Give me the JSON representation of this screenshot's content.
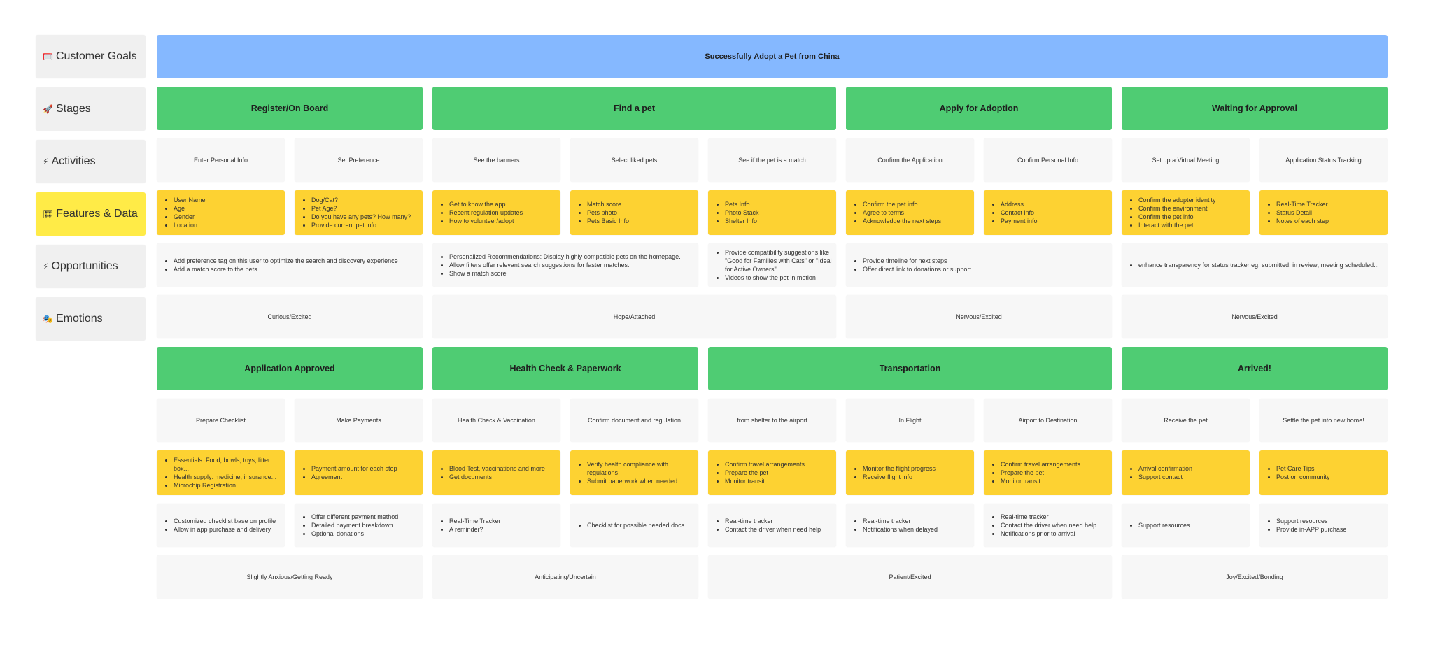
{
  "colors": {
    "goal": "#85b8ff",
    "stage": "#4fcc73",
    "feature": "#fdd232",
    "label_highlight": "#ffeb47",
    "card": "#f7f7f7"
  },
  "labels": [
    {
      "icon": "🥅",
      "text": "Customer Goals"
    },
    {
      "icon": "🚀",
      "text": "Stages"
    },
    {
      "icon": "⚡",
      "text": "Activities"
    },
    {
      "icon": "🎛",
      "text": "Features & Data",
      "highlight": true
    },
    {
      "icon": "⚡",
      "text": "Opportunities"
    },
    {
      "icon": "🎭",
      "text": "Emotions"
    }
  ],
  "goal": "Successfully Adopt a Pet from China",
  "sections": [
    {
      "stages": [
        {
          "label": "Register/On Board",
          "span": 2
        },
        {
          "label": "Find a pet",
          "span": 3
        },
        {
          "label": "Apply for Adoption",
          "span": 2
        },
        {
          "label": "Waiting for Approval",
          "span": 2
        }
      ],
      "activities": [
        "Enter Personal Info",
        "Set Preference",
        "See the banners",
        "Select liked pets",
        "See if the pet is a match",
        "Confirm the Application",
        "Confirm Personal Info",
        "Set up a Virtual Meeting",
        "Application Status Tracking"
      ],
      "features": [
        [
          "User Name",
          "Age",
          "Gender",
          "Location..."
        ],
        [
          "Dog/Cat?",
          "Pet Age?",
          "Do you have any pets? How many?",
          "Provide current pet info"
        ],
        [
          "Get to know the app",
          "Recent regulation updates",
          "How to volunteer/adopt"
        ],
        [
          "Match score",
          "Pets photo",
          "Pets Basic Info"
        ],
        [
          "Pets Info",
          "Photo Stack",
          "Shelter Info"
        ],
        [
          "Confirm the pet info",
          "Agree to terms",
          "Acknowledge the next steps"
        ],
        [
          "Address",
          "Contact info",
          "Payment info"
        ],
        [
          "Confirm the adopter identity",
          "Confirm the environment",
          "Confirm the pet info",
          "Interact with the pet..."
        ],
        [
          "Real-Time Tracker",
          "Status Detail",
          "Notes of each step"
        ]
      ],
      "opportunities": [
        {
          "span": 2,
          "items": [
            "Add preference tag on this user to optimize the search and discovery experience",
            "Add a match score to the pets"
          ]
        },
        {
          "span": 2,
          "items": [
            "Personalized Recommendations: Display highly compatible pets on the homepage.",
            "Allow filters offer relevant search suggestions for faster matches.",
            "Show a match score"
          ]
        },
        {
          "span": 1,
          "items": [
            "Provide compatibility suggestions like \"Good for Families with Cats\" or \"Ideal for Active Owners\"",
            "Videos to show the pet in motion"
          ]
        },
        {
          "span": 2,
          "items": [
            "Provide timeline for next steps",
            "Offer direct link to donations or support"
          ]
        },
        {
          "span": 2,
          "items": [
            "enhance transparency for status tracker eg. submitted; in review; meeting scheduled..."
          ]
        }
      ],
      "emotions": [
        {
          "label": "Curious/Excited",
          "span": 2
        },
        {
          "label": "Hope/Attached",
          "span": 3
        },
        {
          "label": "Nervous/Excited",
          "span": 2
        },
        {
          "label": "Nervous/Excited",
          "span": 2
        }
      ]
    },
    {
      "stages": [
        {
          "label": "Application Approved",
          "span": 2
        },
        {
          "label": "Health Check & Paperwork",
          "span": 2
        },
        {
          "label": "Transportation",
          "span": 3
        },
        {
          "label": "Arrived!",
          "span": 2
        }
      ],
      "activities": [
        "Prepare Checklist",
        "Make Payments",
        "Health Check & Vaccination",
        "Confirm document and regulation",
        "from shelter to the airport",
        "In Flight",
        "Airport to Destination",
        "Receive the pet",
        "Settle the pet into new home!"
      ],
      "features": [
        [
          "Essentials: Food, bowls, toys, litter box...",
          "Health supply: medicine, insurance...",
          "Microchip Registration"
        ],
        [
          "Payment amount for each step",
          "Agreement"
        ],
        [
          "Blood Test, vaccinations and more",
          "Get documents"
        ],
        [
          "Verify health compliance with regulations",
          "Submit paperwork when needed"
        ],
        [
          "Confirm travel arrangements",
          "Prepare the pet",
          "Monitor transit"
        ],
        [
          "Monitor the flight progress",
          "Receive flight info"
        ],
        [
          "Confirm travel arrangements",
          "Prepare the pet",
          "Monitor transit"
        ],
        [
          "Arrival confirmation",
          "Support contact"
        ],
        [
          "Pet Care Tips",
          "Post on community"
        ]
      ],
      "opportunities": [
        {
          "span": 1,
          "items": [
            "Customized checklist base on profile",
            "Allow in app purchase and delivery"
          ]
        },
        {
          "span": 1,
          "items": [
            "Offer different payment method",
            "Detailed payment breakdown",
            "Optional donations"
          ]
        },
        {
          "span": 1,
          "items": [
            "Real-Time Tracker",
            "A reminder?"
          ]
        },
        {
          "span": 1,
          "items": [
            "Checklist for possible needed docs"
          ]
        },
        {
          "span": 1,
          "items": [
            "Real-time tracker",
            "Contact the driver when need help"
          ]
        },
        {
          "span": 1,
          "items": [
            "Real-time tracker",
            "Notifications when delayed"
          ]
        },
        {
          "span": 1,
          "items": [
            "Real-time tracker",
            "Contact the driver when need help",
            "Notifications prior to arrival"
          ]
        },
        {
          "span": 1,
          "items": [
            "Support resources"
          ]
        },
        {
          "span": 1,
          "items": [
            "Support resources",
            "Provide in-APP purchase"
          ]
        }
      ],
      "emotions": [
        {
          "label": "Slightly Anxious/Getting Ready",
          "span": 2
        },
        {
          "label": "Anticipating/Uncertain",
          "span": 2
        },
        {
          "label": "Patient/Excited",
          "span": 3
        },
        {
          "label": "Joy/Excited/Bonding",
          "span": 2
        }
      ]
    }
  ]
}
